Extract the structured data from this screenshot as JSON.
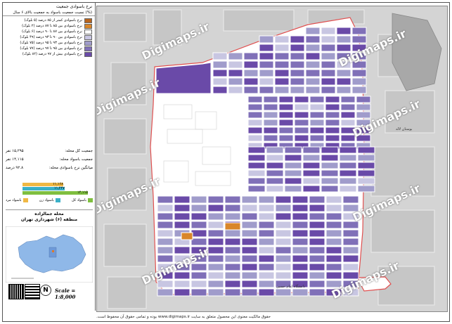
{
  "legend": {
    "title": "نرخ باسوادی جمعیت",
    "subtitle": "نسبت جمعیت باسواد به جمعیت بالای ۶ سال (%)",
    "items": [
      {
        "label": "نرخ باسوادی کمتر از ۸۵ درصد (۵ بلوک)",
        "color": "#b8641e"
      },
      {
        "label": "نرخ باسوادی بین ۸۵ تا ۸۷ درصد (۲ بلوک)",
        "color": "#d9862a"
      },
      {
        "label": "نرخ باسوادی بین ۸۷ تا ۹۰ درصد (۶ بلوک)",
        "color": "#ffffff"
      },
      {
        "label": "نرخ باسوادی بین ۹۰ تا ۹۳ درصد (۴۹ بلوک)",
        "color": "#c8c6e2"
      },
      {
        "label": "نرخ باسوادی بین ۹۳ تا ۹۵ درصد (۷۵ بلوک)",
        "color": "#a09ccb"
      },
      {
        "label": "نرخ باسوادی بین ۹۵ تا ۹۷ درصد (۷۷ بلوک)",
        "color": "#8070b8"
      },
      {
        "label": "نرخ باسوادی بیش از ۹۷ درصد (۸۲ بلوک)",
        "color": "#6a4aa8"
      }
    ]
  },
  "stats": [
    {
      "label": "جمعیت کل محله:",
      "value": "۱۵,۲۹۵ نفر"
    },
    {
      "label": "جمعیت باسواد محله:",
      "value": "۱۴,۱۱۵ نفر"
    },
    {
      "label": "میانگین نرخ باسوادی محله:",
      "value": "۹۲.۸ درصد"
    }
  ],
  "bars": [
    {
      "value": "۱۱,۱۶۸",
      "color": "#f0b844",
      "pct": 0.58
    },
    {
      "value": "۱۱,۴۴۷",
      "color": "#3ab0c8",
      "pct": 0.6
    },
    {
      "value": "۱۴,۱۱۵",
      "color": "#7fbf3f",
      "pct": 0.93
    }
  ],
  "bar_legend": [
    "باسواد کل",
    "باسواد زن",
    "باسواد مرد"
  ],
  "bar_legend_colors": [
    "#7fbf3f",
    "#3ab0c8",
    "#f0b844"
  ],
  "neighborhood": {
    "name": "محله جمالزاده",
    "district": "منطقه (۶) شهرداری تهران"
  },
  "scale": "Scale = 1:8,000",
  "north": "N",
  "watermark": "Digimaps.ir",
  "footer": "حقوق مالکیت معنوی این محصول متعلق به سایت www.digimaps.ir بوده و تمامی حقوق آن محفوظ است.",
  "map_labels": [
    "دانشگاه امام حسین",
    "بوستان لاله"
  ],
  "colors": {
    "boundary": "#e05050",
    "purple_dark": "#6a4aa8",
    "purple_mid": "#8070b8",
    "purple_light": "#a09ccb",
    "lavender": "#c8c6e2",
    "orange": "#d9862a",
    "brown": "#b8641e"
  }
}
